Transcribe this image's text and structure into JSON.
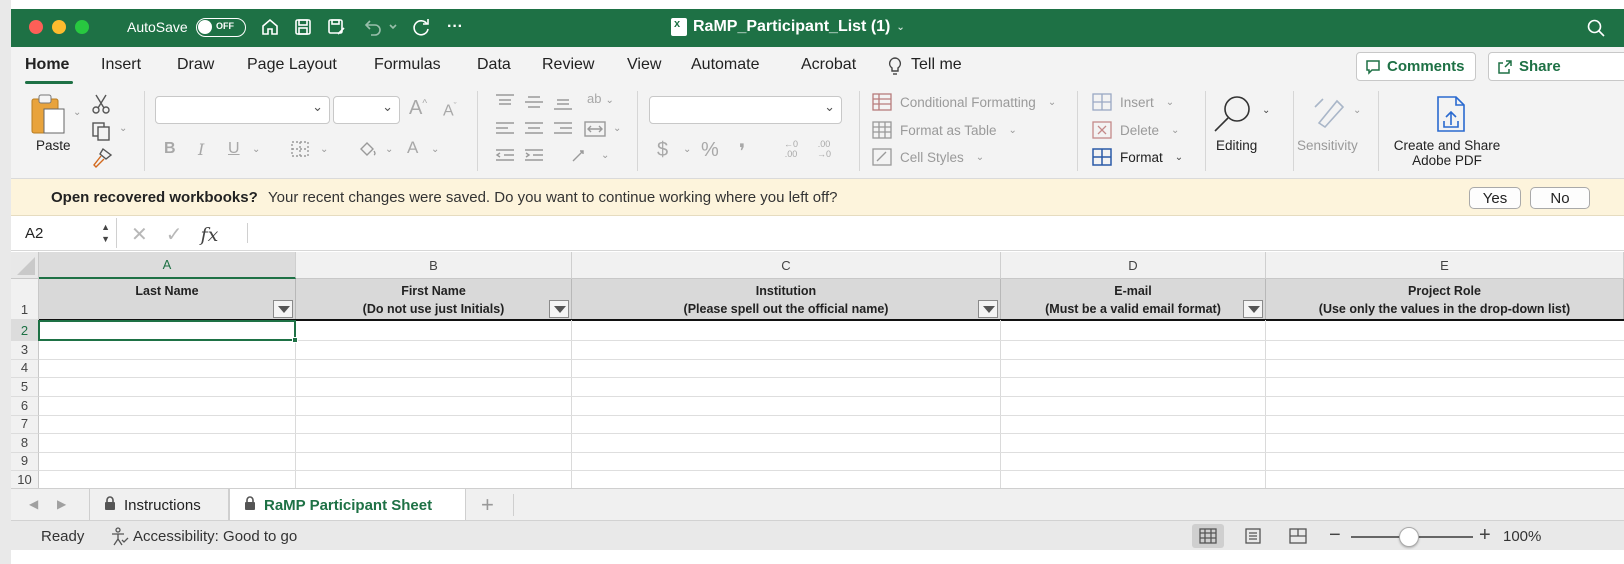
{
  "titlebar": {
    "autosave_label": "AutoSave",
    "autosave_state": "OFF",
    "window_title": "RaMP_Participant_List (1)",
    "title_chevron": "⌄",
    "more": "···"
  },
  "ribbon_tabs": {
    "items": [
      "Home",
      "Insert",
      "Draw",
      "Page Layout",
      "Formulas",
      "Data",
      "Review",
      "View",
      "Automate",
      "Acrobat"
    ],
    "tell_me": "Tell me",
    "comments": "Comments",
    "share": "Share"
  },
  "ribbon": {
    "paste": "Paste",
    "conditional_formatting": "Conditional Formatting",
    "format_as_table": "Format as Table",
    "cell_styles": "Cell Styles",
    "insert": "Insert",
    "delete": "Delete",
    "format": "Format",
    "editing": "Editing",
    "sensitivity": "Sensitivity",
    "create_share_line1": "Create and Share",
    "create_share_line2": "Adobe PDF",
    "bold": "B",
    "italic": "I",
    "underline": "U",
    "font_grow": "A",
    "font_shrink": "A",
    "font_color": "A",
    "orientation": "ab",
    "currency": "$",
    "percent": "%",
    "comma": "❜",
    "inc_decimal_top": "←0",
    "inc_decimal_bottom": ".00",
    "dec_decimal_top": ".00",
    "dec_decimal_bottom": "→0"
  },
  "notification": {
    "title": "Open recovered workbooks?",
    "message": "Your recent changes were saved. Do you want to continue working where you left off?",
    "yes": "Yes",
    "no": "No"
  },
  "formula_bar": {
    "name_box": "A2",
    "cancel": "✕",
    "enter": "✓",
    "fx": "fx",
    "value": ""
  },
  "grid": {
    "columns": [
      "A",
      "B",
      "C",
      "D",
      "E"
    ],
    "rows": [
      "1",
      "2",
      "3",
      "4",
      "5",
      "6",
      "7",
      "8",
      "9",
      "10"
    ],
    "headers": [
      {
        "line1": "Last Name",
        "line2": ""
      },
      {
        "line1": "First Name",
        "line2": "(Do not use just Initials)"
      },
      {
        "line1": "Institution",
        "line2": "(Please spell out the official name)"
      },
      {
        "line1": "E-mail",
        "line2": "(Must be a valid email format)"
      },
      {
        "line1": "Project Role",
        "line2": "(Use only the values in the drop-down list)"
      }
    ],
    "selected_cell": "A2"
  },
  "sheet_tabs": {
    "prev": "◀",
    "next": "▶",
    "tabs": [
      "Instructions",
      "RaMP Participant Sheet"
    ],
    "add": "+"
  },
  "statusbar": {
    "ready": "Ready",
    "accessibility": "Accessibility: Good to go",
    "zoom_minus": "−",
    "zoom_plus": "+",
    "zoom": "100%",
    "zoom_level_percent": 100
  },
  "colors": {
    "accent": "#1e7145",
    "notification_bg": "#fdf4dc",
    "header_fill": "#d9d9d9"
  },
  "icons": {
    "titlebar": [
      "home-icon",
      "save-icon",
      "save-as-icon",
      "undo-icon",
      "redo-icon",
      "more-icon",
      "search-icon"
    ],
    "ribbon": [
      "paste-icon",
      "cut-icon",
      "copy-icon",
      "format-painter-icon",
      "borders-icon",
      "fill-color-icon",
      "align-icon",
      "wrap-icon",
      "merge-icon",
      "indent-icon",
      "orientation-icon",
      "conditional-formatting-icon",
      "format-as-table-icon",
      "cell-styles-icon",
      "insert-cells-icon",
      "delete-cells-icon",
      "format-cells-icon",
      "search-magnifier-icon",
      "sensitivity-icon",
      "adobe-pdf-icon"
    ],
    "tabs": [
      "lightbulb-icon",
      "comment-icon",
      "share-icon",
      "lock-icon",
      "accessibility-icon",
      "normal-view-icon",
      "page-layout-view-icon",
      "page-break-view-icon"
    ]
  }
}
